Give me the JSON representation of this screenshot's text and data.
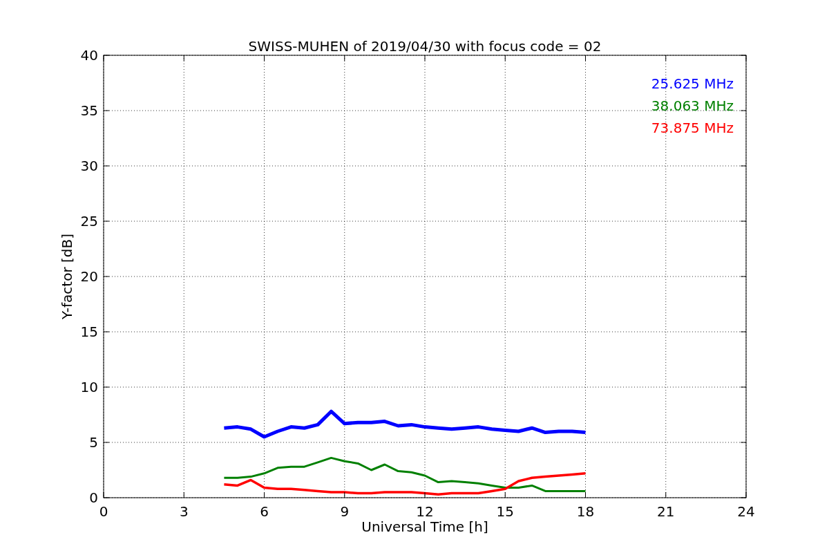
{
  "figure": {
    "chart_data": {
      "type": "line",
      "title": "SWISS-MUHEN of 2019/04/30 with focus code = 02",
      "xlabel": "Universal Time [h]",
      "ylabel": "Y-factor [dB]",
      "x": [
        4.5,
        5,
        5.5,
        6,
        6.5,
        7,
        7.5,
        8,
        8.5,
        9,
        9.5,
        10,
        10.5,
        11,
        11.5,
        12,
        12.5,
        13,
        13.5,
        14,
        14.5,
        15,
        15.5,
        16,
        16.5,
        17,
        17.5,
        18
      ],
      "series": [
        {
          "name": "25.625 MHz",
          "color": "#0000ff",
          "values": [
            6.3,
            6.4,
            6.2,
            5.5,
            6.0,
            6.4,
            6.3,
            6.6,
            7.8,
            6.7,
            6.8,
            6.8,
            6.9,
            6.5,
            6.6,
            6.4,
            6.3,
            6.2,
            6.3,
            6.4,
            6.2,
            6.1,
            6.0,
            6.3,
            5.9,
            6.0,
            6.0,
            5.9
          ]
        },
        {
          "name": "38.063 MHz",
          "color": "#008000",
          "values": [
            1.8,
            1.8,
            1.9,
            2.2,
            2.7,
            2.8,
            2.8,
            3.2,
            3.6,
            3.3,
            3.1,
            2.5,
            3.0,
            2.4,
            2.3,
            2.0,
            1.4,
            1.5,
            1.4,
            1.3,
            1.1,
            0.9,
            0.9,
            1.1,
            0.6,
            0.6,
            0.6,
            0.6
          ]
        },
        {
          "name": "73.875 MHz",
          "color": "#ff0000",
          "values": [
            1.2,
            1.1,
            1.6,
            0.9,
            0.8,
            0.8,
            0.7,
            0.6,
            0.5,
            0.5,
            0.4,
            0.4,
            0.5,
            0.5,
            0.5,
            0.4,
            0.3,
            0.4,
            0.4,
            0.4,
            0.6,
            0.8,
            1.5,
            1.8,
            1.9,
            2.0,
            2.1,
            2.2
          ]
        }
      ],
      "grid": true,
      "xlim": [
        0,
        24
      ],
      "ylim": [
        0,
        40
      ],
      "xticks": [
        0,
        3,
        6,
        9,
        12,
        15,
        18,
        21,
        24
      ],
      "yticks": [
        0,
        5,
        10,
        15,
        20,
        25,
        30,
        35,
        40
      ]
    }
  }
}
